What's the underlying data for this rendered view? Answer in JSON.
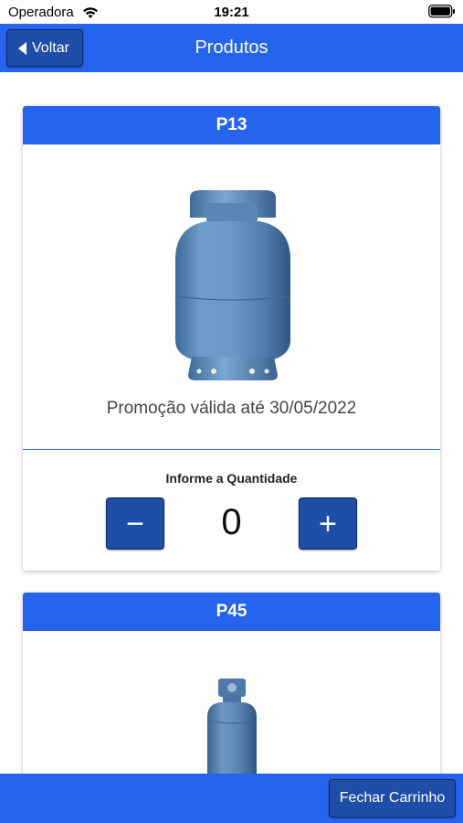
{
  "status_bar": {
    "carrier": "Operadora",
    "time": "19:21",
    "wifi_icon": "wifi-icon",
    "battery_icon": "battery-icon"
  },
  "nav": {
    "back_label": "Voltar",
    "back_icon": "chevron-left-icon",
    "title": "Produtos"
  },
  "products": [
    {
      "name": "P13",
      "image": "gas-cylinder-p13",
      "promo": "Promoção válida até 30/05/2022",
      "quantity_label": "Informe a Quantidade",
      "quantity": "0",
      "minus_label": "−",
      "plus_label": "+"
    },
    {
      "name": "P45",
      "image": "gas-cylinder-p45"
    }
  ],
  "footer": {
    "checkout_label": "Fechar Carrinho"
  },
  "colors": {
    "primary": "#2565ed",
    "button": "#1d4ea8",
    "cylinder": "#5f8fc2"
  }
}
